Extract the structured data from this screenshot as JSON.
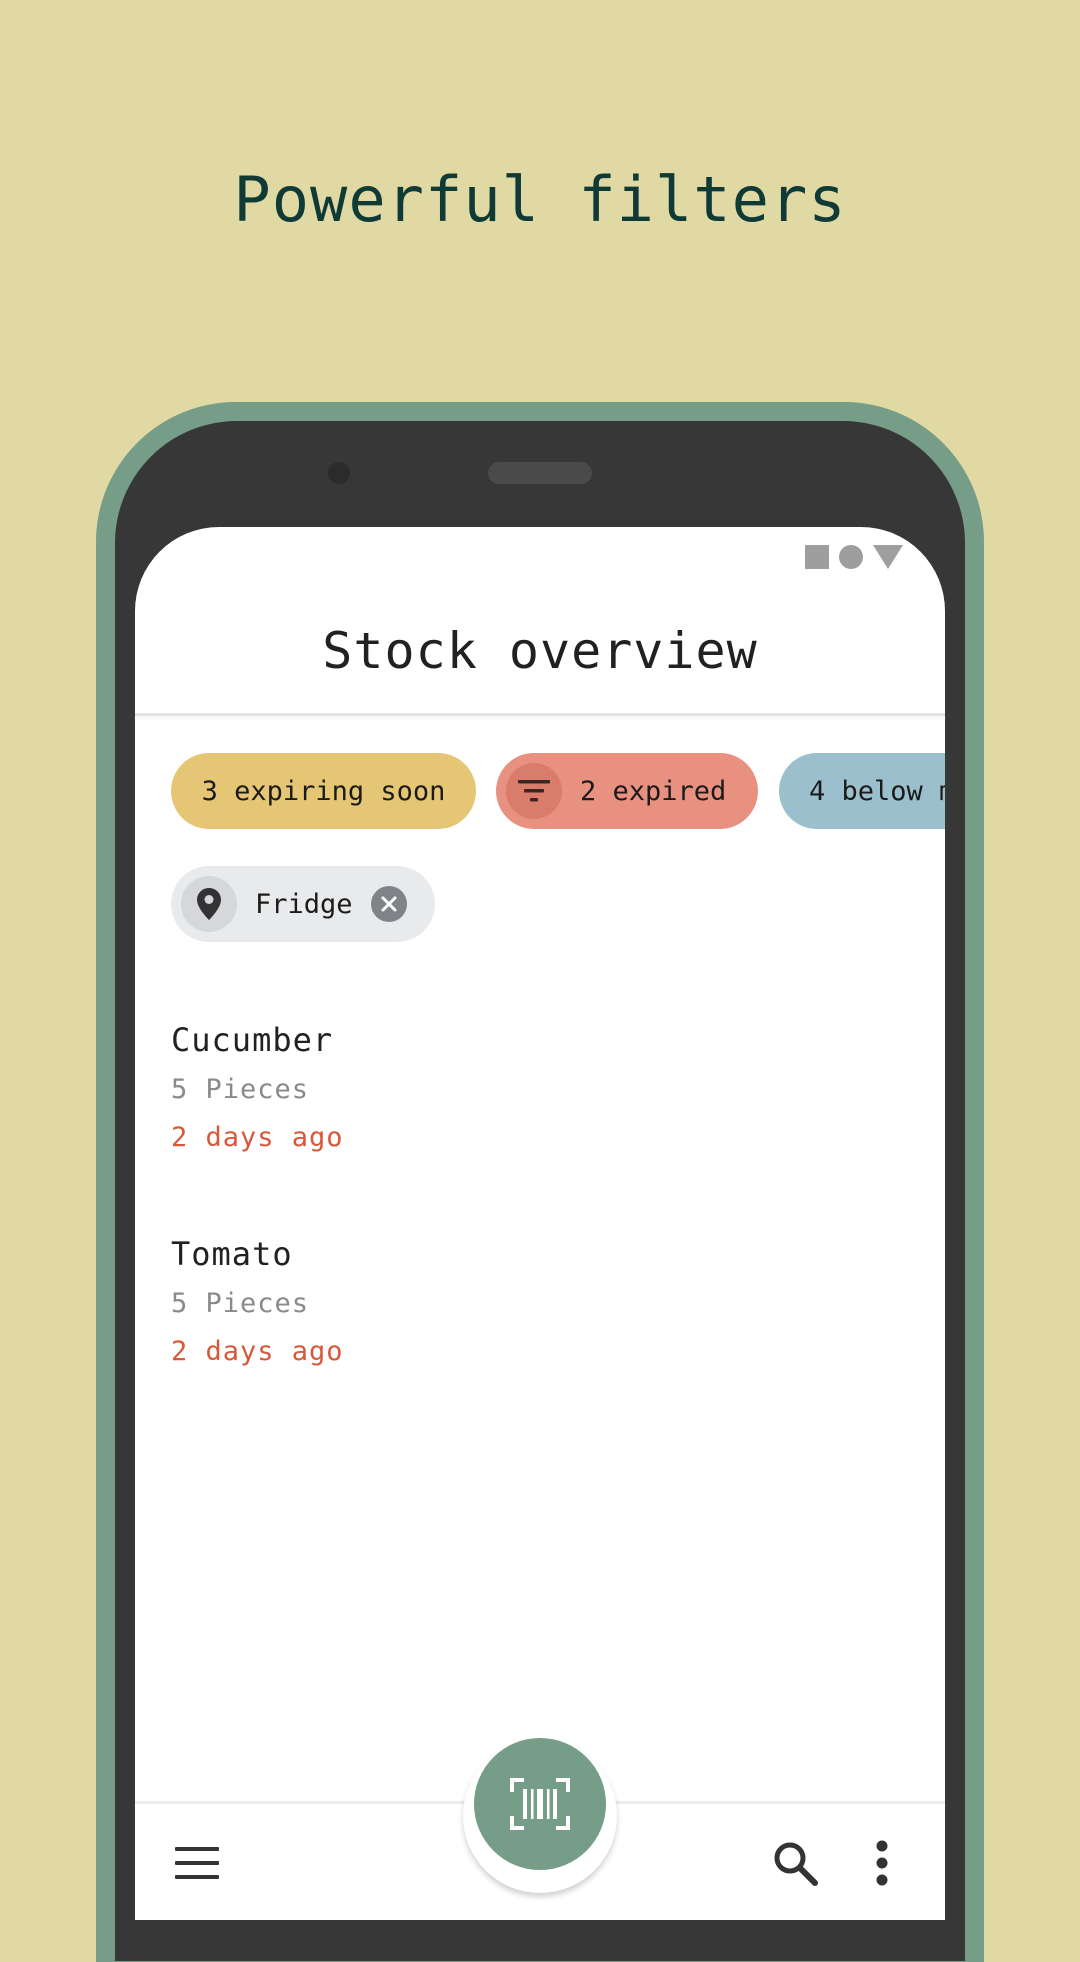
{
  "headline": "Powerful filters",
  "app": {
    "title": "Stock overview"
  },
  "status_bar": {
    "icons": [
      "square-icon",
      "circle-icon",
      "triangle-icon"
    ]
  },
  "filter_chips": [
    {
      "label": "3 expiring soon",
      "color": "#e5c674"
    },
    {
      "label": "2 expired",
      "color": "#e89180",
      "icon": "filter-icon",
      "selected": true
    },
    {
      "label": "4 below m",
      "color": "#9bbfcc"
    }
  ],
  "location_chip": {
    "label": "Fridge",
    "icon": "location-pin-icon",
    "close_icon": "close-icon"
  },
  "items": [
    {
      "name": "Cucumber",
      "amount": "5 Pieces",
      "date": "2 days ago"
    },
    {
      "name": "Tomato",
      "amount": "5 Pieces",
      "date": "2 days ago"
    }
  ],
  "bottom_bar": {
    "menu_icon": "menu-icon",
    "fab_icon": "barcode-scan-icon",
    "search_icon": "search-icon",
    "more_icon": "more-vert-icon"
  },
  "colors": {
    "background": "#e0d9a3",
    "phone_frame": "#759d87",
    "headline": "#0f3a36",
    "fab": "#759d87",
    "date_warning": "#d9583a"
  }
}
